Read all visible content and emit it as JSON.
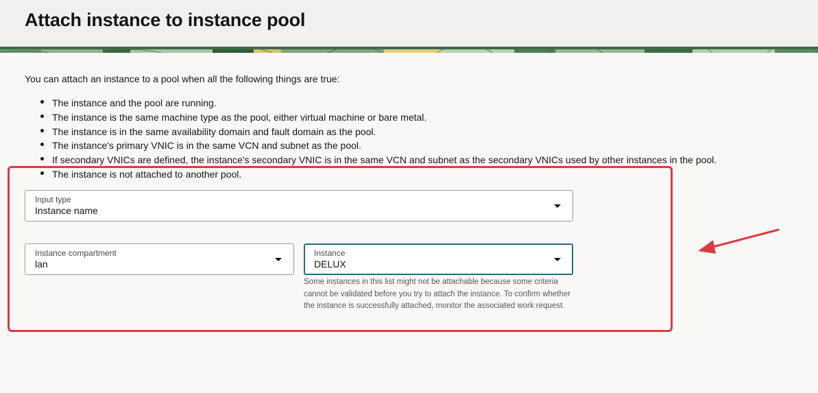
{
  "page": {
    "title": "Attach instance to instance pool",
    "intro": "You can attach an instance to a pool when all the following things are true:",
    "requirements": [
      "The instance and the pool are running.",
      "The instance is the same machine type as the pool, either virtual machine or bare metal.",
      "The instance is in the same availability domain and fault domain as the pool.",
      "The instance's primary VNIC is in the same VCN and subnet as the pool.",
      "If secondary VNICs are defined, the instance's secondary VNIC is in the same VCN and subnet as the secondary VNICs used by other instances in the pool.",
      "The instance is not attached to another pool."
    ]
  },
  "form": {
    "input_type": {
      "label": "Input type",
      "value": "Instance name"
    },
    "compartment": {
      "label": "Instance compartment",
      "value": "lan"
    },
    "instance": {
      "label": "Instance",
      "value": "DELUX",
      "help": "Some instances in this list might not be attachable because some criteria cannot be validated before you try to attach the instance. To confirm whether the instance is successfully attached, monitor the associated work request."
    }
  },
  "icons": {
    "dropdown": "chevron-down-icon",
    "annotation": "red-arrow-annotation"
  },
  "colors": {
    "annotation_red": "#dc3b41",
    "focus_border": "#2b6a83",
    "header_bg": "#f1f0ef",
    "page_bg": "#f9f8f6",
    "banner_green": "#3f6a4a"
  }
}
